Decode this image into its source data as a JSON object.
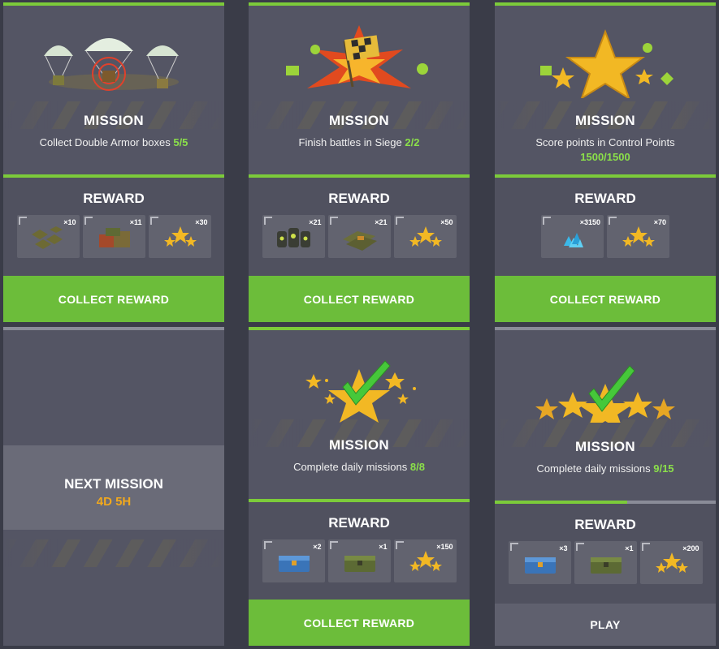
{
  "cards": [
    {
      "mission_title": "MISSION",
      "mission_desc": "Collect Double Armor boxes",
      "progress": "5/5",
      "art": "parachute-crates",
      "reward_title": "REWARD",
      "rewards": [
        {
          "icon": "double-armor-box-icon",
          "qty": "×10"
        },
        {
          "icon": "supply-crate-icon",
          "qty": "×11"
        },
        {
          "icon": "stars-icon",
          "qty": "×30"
        }
      ],
      "button": "COLLECT REWARD"
    },
    {
      "mission_title": "MISSION",
      "mission_desc": "Finish battles in Siege",
      "progress": "2/2",
      "art": "checkered-flag-explosion",
      "reward_title": "REWARD",
      "rewards": [
        {
          "icon": "fuel-barrels-icon",
          "qty": "×21"
        },
        {
          "icon": "repair-kits-icon",
          "qty": "×21"
        },
        {
          "icon": "stars-icon",
          "qty": "×50"
        }
      ],
      "button": "COLLECT REWARD"
    },
    {
      "mission_title": "MISSION",
      "mission_desc": "Score points in Control Points",
      "progress": "1500/1500",
      "art": "big-star",
      "reward_title": "REWARD",
      "rewards": [
        {
          "icon": "crystals-icon",
          "qty": "×3150"
        },
        {
          "icon": "stars-icon",
          "qty": "×70"
        }
      ],
      "button": "COLLECT REWARD"
    },
    {
      "next_title": "NEXT MISSION",
      "next_time": "4D 5H"
    },
    {
      "mission_title": "MISSION",
      "mission_desc": "Complete daily missions",
      "progress": "8/8",
      "art": "star-checkmark",
      "reward_title": "REWARD",
      "rewards": [
        {
          "icon": "blue-container-icon",
          "qty": "×2"
        },
        {
          "icon": "green-container-icon",
          "qty": "×1"
        },
        {
          "icon": "stars-icon",
          "qty": "×150"
        }
      ],
      "button": "COLLECT REWARD"
    },
    {
      "mission_title": "MISSION",
      "mission_desc": "Complete daily missions",
      "progress": "9/15",
      "progress_fraction": 0.6,
      "art": "stars-row-checkmark",
      "reward_title": "REWARD",
      "rewards": [
        {
          "icon": "blue-container-icon",
          "qty": "×3"
        },
        {
          "icon": "green-container-icon",
          "qty": "×1"
        },
        {
          "icon": "stars-icon",
          "qty": "×200"
        }
      ],
      "button": "PLAY"
    }
  ],
  "colors": {
    "accent_green": "#7ccb3a",
    "progress_text": "#8be04a",
    "timer_orange": "#f0a81e",
    "card_bg": "#545564"
  }
}
